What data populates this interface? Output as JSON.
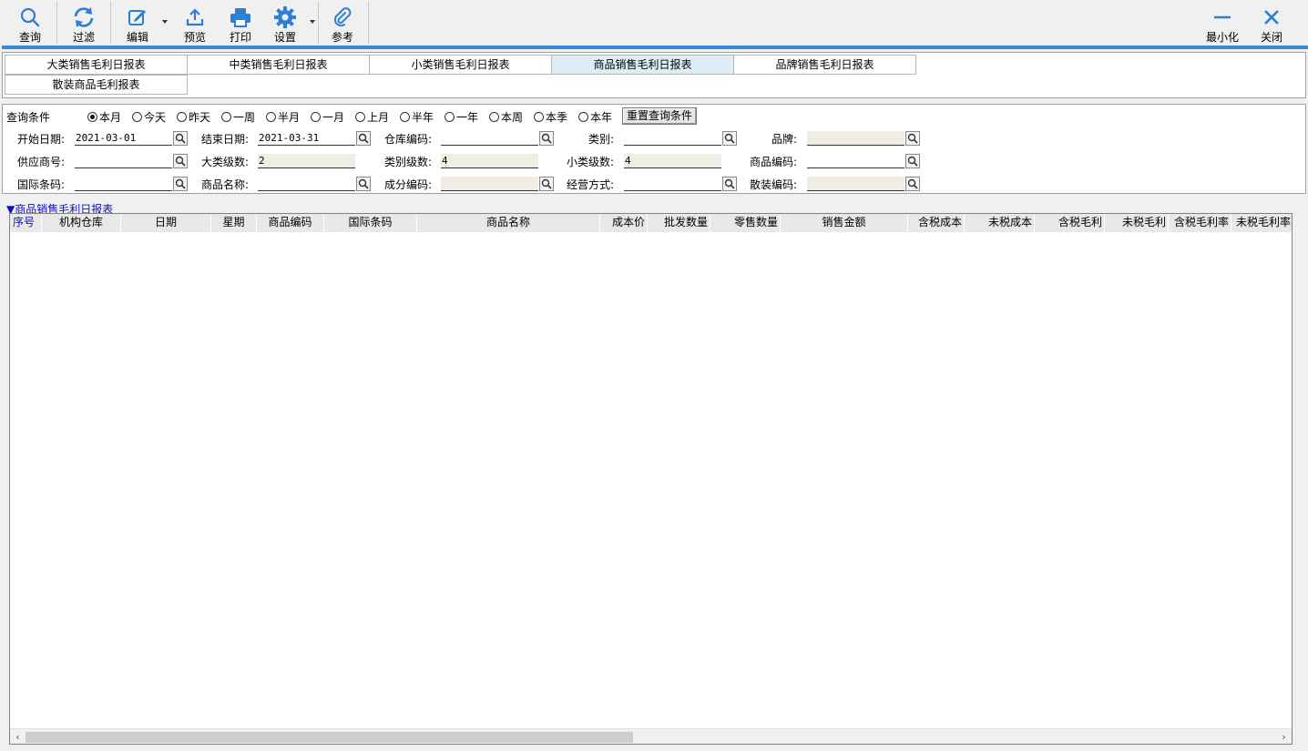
{
  "toolbar": {
    "query": "查询",
    "filter": "过滤",
    "edit": "编辑",
    "preview": "预览",
    "print": "打印",
    "settings": "设置",
    "reference": "参考",
    "minimize": "最小化",
    "close": "关闭"
  },
  "tabs": {
    "t1": "大类销售毛利日报表",
    "t2": "中类销售毛利日报表",
    "t3": "小类销售毛利日报表",
    "t4": "商品销售毛利日报表",
    "t5": "品牌销售毛利日报表",
    "t6": "散装商品毛利报表",
    "active": "商品销售毛利日报表"
  },
  "query": {
    "title": "查询条件",
    "periods": [
      "本月",
      "今天",
      "昨天",
      "一周",
      "半月",
      "一月",
      "上月",
      "半年",
      "一年",
      "本周",
      "本季",
      "本年"
    ],
    "selected_period": "本月",
    "reset_label": "重置查询条件",
    "fields": {
      "start_date": {
        "label": "开始日期:",
        "value": "2021-03-01"
      },
      "end_date": {
        "label": "结束日期:",
        "value": "2021-03-31"
      },
      "warehouse": {
        "label": "仓库编码:",
        "value": ""
      },
      "category": {
        "label": "类别:",
        "value": ""
      },
      "brand": {
        "label": "品牌:",
        "value": ""
      },
      "supplier": {
        "label": "供应商号:",
        "value": ""
      },
      "major_level": {
        "label": "大类级数:",
        "value": "2"
      },
      "category_level": {
        "label": "类别级数:",
        "value": "4"
      },
      "minor_level": {
        "label": "小类级数:",
        "value": "4"
      },
      "product_code": {
        "label": "商品编码:",
        "value": ""
      },
      "barcode": {
        "label": "国际条码:",
        "value": ""
      },
      "product_name": {
        "label": "商品名称:",
        "value": ""
      },
      "component_code": {
        "label": "成分编码:",
        "value": ""
      },
      "business_mode": {
        "label": "经营方式:",
        "value": ""
      },
      "bulk_code": {
        "label": "散装编码:",
        "value": ""
      }
    }
  },
  "grid": {
    "title": "▼商品销售毛利日报表",
    "columns": [
      "序号",
      "机构仓库",
      "日期",
      "星期",
      "商品编码",
      "国际条码",
      "商品名称",
      "成本价",
      "批发数量",
      "零售数量",
      "销售金额",
      "含税成本",
      "未税成本",
      "含税毛利",
      "未税毛利",
      "含税毛利率",
      "未税毛利率"
    ]
  },
  "colors": {
    "accent": "#3a8ad8",
    "icon_blue": "#2b7fd4",
    "active_tab": "#deeef8",
    "readonly_field": "#f0eee4"
  }
}
